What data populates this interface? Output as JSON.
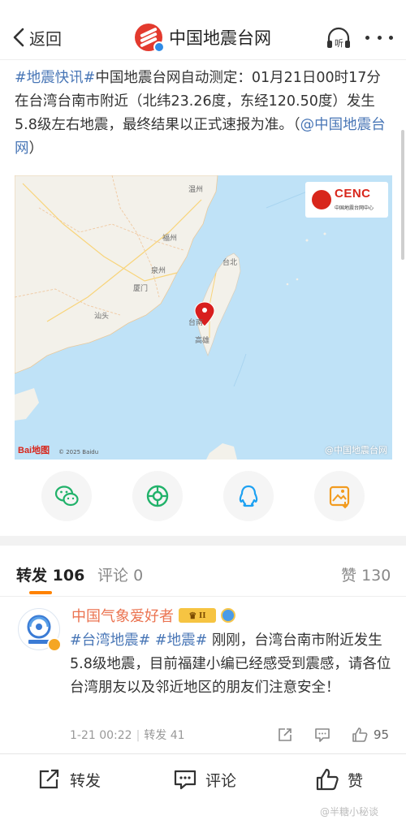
{
  "nav": {
    "back_label": "返回",
    "title": "中国地震台网",
    "listen_label": "听"
  },
  "post": {
    "tag_flash": "#地震快讯#",
    "body": "中国地震台网自动测定：01月21日00时17分在台湾台南市附近（北纬23.26度，东经120.50度）发生5.8级左右地震，最终结果以正式速报为准。（",
    "mention": "@中国地震台网",
    "tail": "）"
  },
  "map": {
    "cenc_name": "CENC",
    "cenc_sub": "中国地震台网中心",
    "baidu": "Bai地图",
    "copyright": "© 2025 Baidu",
    "watermark": "@中国地震台网",
    "pin_color": "#d81e1e",
    "labels": {
      "fuzhou": "福州",
      "taibei": "台北",
      "tainan": "台南",
      "gaoxiong": "高雄",
      "xiamen": "厦门",
      "shantou": "汕头",
      "quanzhou": "泉州",
      "wenzhou": "温州"
    }
  },
  "share": {
    "icons": [
      "wechat-icon",
      "moments-icon",
      "qq-icon",
      "save-image-icon"
    ]
  },
  "tabs": {
    "repost_label": "转发",
    "repost_count": "106",
    "comment_label": "评论",
    "comment_count": "0",
    "like_label": "赞",
    "like_count": "130"
  },
  "item": {
    "author": "中国气象爱好者",
    "level": "II",
    "tag1": "#台湾地震#",
    "tag2": "#地震#",
    "text": "刚刚，台湾台南市附近发生5.8级地震，目前福建小编已经感受到震感，请各位台湾朋友以及邻近地区的朋友们注意安全！",
    "time": "1-21 00:22",
    "repost": "转发 41",
    "likes": "95"
  },
  "bottom": {
    "repost": "转发",
    "comment": "评论",
    "like": "赞",
    "watermark": "@半糖小秘谈"
  },
  "colors": {
    "accent": "#ff8200",
    "link": "#4876b6",
    "author": "#eb7350",
    "sea": "#bfe2f7",
    "land": "#f3f1ea"
  }
}
